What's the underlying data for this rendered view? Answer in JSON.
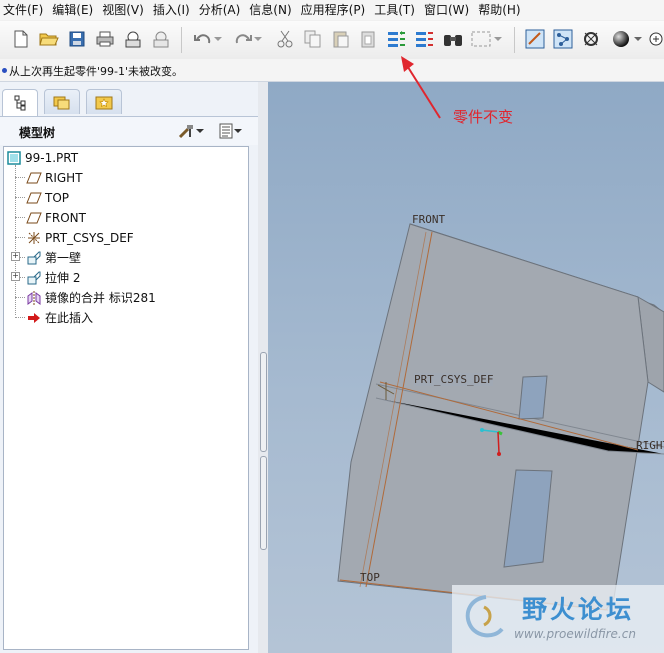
{
  "menu": [
    "文件(F)",
    "编辑(E)",
    "视图(V)",
    "插入(I)",
    "分析(A)",
    "信息(N)",
    "应用程序(P)",
    "工具(T)",
    "窗口(W)",
    "帮助(H)"
  ],
  "message": "从上次再生起零件'99-1'未被改变。",
  "annotation": "零件不变",
  "tree": {
    "title": "模型树",
    "root": "99-1.PRT",
    "items": [
      "RIGHT",
      "TOP",
      "FRONT",
      "PRT_CSYS_DEF",
      "第一壁",
      "拉伸 2",
      "镜像的合并 标识281",
      "在此插入"
    ]
  },
  "viewport_labels": {
    "front": "FRONT",
    "top": "TOP",
    "right": "RIGHT",
    "csys": "PRT_CSYS_DEF"
  },
  "watermark": {
    "text": "野火论坛",
    "url": "www.proewildfire.cn"
  },
  "colors": {
    "annotation": "#e0262e",
    "datum": "#b06a3a",
    "viewport_bg": "#9ab1ca",
    "part_fill": "#a3a9b1"
  }
}
